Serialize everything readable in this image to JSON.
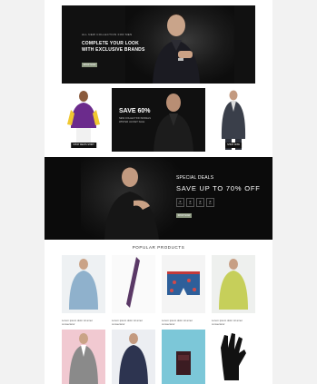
{
  "hero": {
    "subtitle": "ALL NEW COLLECTION FOR MEN",
    "headline_line1": "COMPLETE YOUR LOOK",
    "headline_line2": "WITH EXCLUSIVE BRANDS",
    "button_label": "SHOP NOW"
  },
  "banners": [
    {
      "button_label": "SHOP MEN'S SHIRT"
    },
    {
      "title": "SAVE 60%",
      "subtitle": "NEW COLLECTION MODELS WINTER JACKET SALE"
    },
    {
      "button_label": "SHOP NOW"
    }
  ],
  "deals": {
    "label": "SPECIAL DEALS",
    "offer": "SAVE UP TO 70% OFF",
    "timer": [
      {
        "value": "0",
        "unit": "Days"
      },
      {
        "value": "0",
        "unit": "Hrs"
      },
      {
        "value": "0",
        "unit": "Min"
      },
      {
        "value": "0",
        "unit": "Sec"
      }
    ],
    "button_label": "SHOP NOW"
  },
  "products_title": "POPULAR PRODUCTS",
  "products": [
    {
      "name": "Lorem ipsum dolor sit amet consectetur"
    },
    {
      "name": "Lorem ipsum dolor sit amet consectetur"
    },
    {
      "name": "Lorem ipsum dolor sit amet consectetur"
    },
    {
      "name": "Lorem ipsum dolor sit amet consectetur"
    },
    {
      "name": ""
    },
    {
      "name": ""
    },
    {
      "name": ""
    },
    {
      "name": ""
    }
  ]
}
